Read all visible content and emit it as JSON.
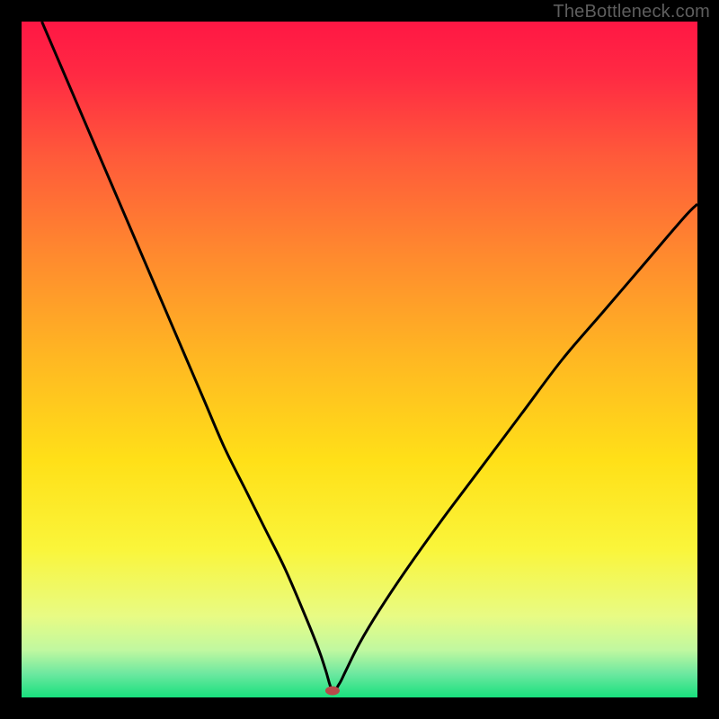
{
  "watermark": "TheBottleneck.com",
  "chart_data": {
    "type": "line",
    "title": "",
    "xlabel": "",
    "ylabel": "",
    "xlim": [
      0,
      100
    ],
    "ylim": [
      0,
      100
    ],
    "grid": false,
    "background_gradient": {
      "stops": [
        {
          "offset": 0.0,
          "color": "#ff1744"
        },
        {
          "offset": 0.08,
          "color": "#ff2a43"
        },
        {
          "offset": 0.2,
          "color": "#ff5a3a"
        },
        {
          "offset": 0.35,
          "color": "#ff8b2e"
        },
        {
          "offset": 0.5,
          "color": "#ffb822"
        },
        {
          "offset": 0.65,
          "color": "#ffe018"
        },
        {
          "offset": 0.78,
          "color": "#faf53a"
        },
        {
          "offset": 0.88,
          "color": "#e8fb84"
        },
        {
          "offset": 0.93,
          "color": "#c0f8a0"
        },
        {
          "offset": 0.965,
          "color": "#6de8a0"
        },
        {
          "offset": 1.0,
          "color": "#18e07d"
        }
      ]
    },
    "marker": {
      "x": 46,
      "y": 1,
      "color": "#b74a4a",
      "rx": 8,
      "ry": 5
    },
    "series": [
      {
        "name": "curve",
        "color": "#000000",
        "x": [
          3,
          6,
          9,
          12,
          15,
          18,
          21,
          24,
          27,
          30,
          33,
          36,
          39,
          42,
          44,
          45,
          46,
          47,
          48,
          50,
          53,
          57,
          62,
          68,
          74,
          80,
          86,
          92,
          98,
          100
        ],
        "y": [
          100,
          93,
          86,
          79,
          72,
          65,
          58,
          51,
          44,
          37,
          31,
          25,
          19,
          12,
          7,
          4,
          1,
          2,
          4,
          8,
          13,
          19,
          26,
          34,
          42,
          50,
          57,
          64,
          71,
          73
        ]
      }
    ]
  }
}
